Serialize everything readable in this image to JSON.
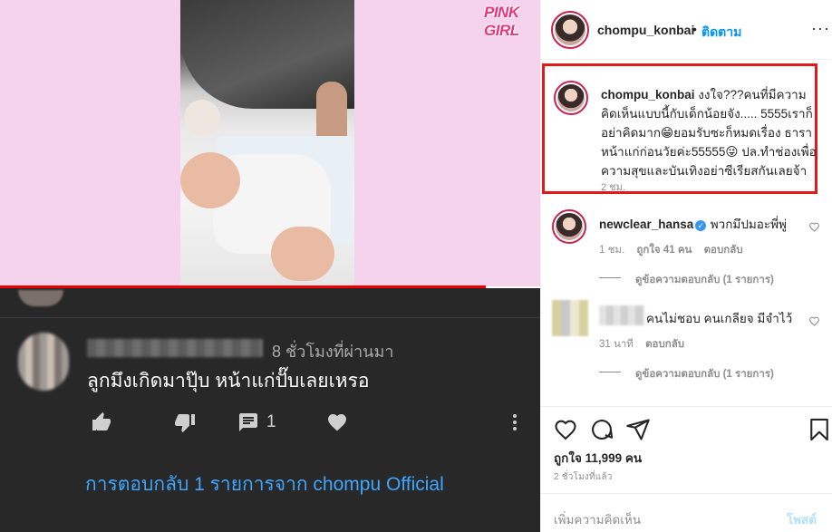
{
  "video": {
    "brand_logo": "PINK GIRL"
  },
  "youtube_comment": {
    "time": "8 ชั่วโมงที่ผ่านมา",
    "text": "ลูกมึงเกิดมาปุ๊บ หน้าแก่ปั๊บเลยเหรอ",
    "reply_count": "1",
    "replies_link": "การตอบกลับ 1 รายการจาก chompu Official"
  },
  "post": {
    "username": "chompu_konbai",
    "separator": "•",
    "follow_label": "ติดตาม",
    "more_label": "···",
    "caption": {
      "username": "chompu_konbai",
      "text": "งงใจ???คนที่มีความคิดเห็นแบบนี้กับเด็กน้อยจัง..... 5555เราก็อย่าคิดมาก😁ยอมรับซะก็หมดเรื่อง ธาราหน้าแก่ก่อนวัยค่ะ55555😜 ปล.ทำช่องเพื่อความสุขและบันเทิงอย่าซีเรียสกันเลยจ้า",
      "time": "2 ชม."
    },
    "comments": [
      {
        "username": "newclear_hansa",
        "verified": true,
        "text": "พวกมึปมอะพี่พู่",
        "time": "1 ชม.",
        "likes": "ถูกใจ 41 คน",
        "reply_label": "ตอบกลับ",
        "view_replies": "ดูข้อความตอบกลับ (1 รายการ)"
      },
      {
        "text": "คนไม่ชอบ คนเกลียจ มีจำไว้",
        "time": "31 นาที",
        "reply_label": "ตอบกลับ",
        "view_replies": "ดูข้อความตอบกลับ (1 รายการ)"
      }
    ],
    "likes": "ถูกใจ 11,999 คน",
    "posted": "2 ชั่วโมงที่แล้ว",
    "add_comment_placeholder": "เพิ่มความคิดเห็น",
    "post_button": "โพสต์"
  },
  "colors": {
    "video_bg": "#f6d3ec",
    "dark_bg": "#282828",
    "link_blue": "#3ea6ff",
    "ig_blue": "#0095f6",
    "highlight_red": "#e01a1a"
  }
}
